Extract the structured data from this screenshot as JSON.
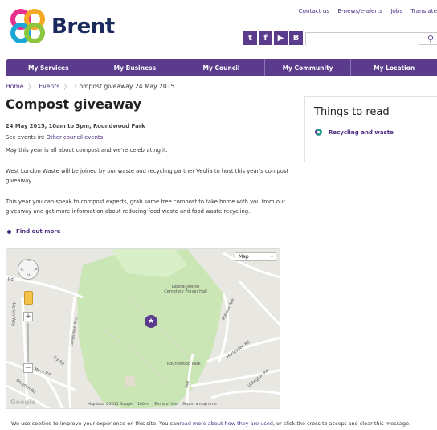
{
  "brand": {
    "name": "Brent",
    "colors": {
      "primary": "#5b3b8c",
      "link": "#4b2e83",
      "text": "#222222"
    }
  },
  "toplinks": [
    "Contact us",
    "E-news/e-alerts",
    "Jobs",
    "Translate"
  ],
  "social": [
    {
      "icon": "twitter-icon",
      "glyph": "t"
    },
    {
      "icon": "facebook-icon",
      "glyph": "f"
    },
    {
      "icon": "youtube-icon",
      "glyph": "▶"
    },
    {
      "icon": "brent-b-icon",
      "glyph": "B"
    }
  ],
  "search": {
    "placeholder": "",
    "icon": "search-icon"
  },
  "nav": [
    "My Services",
    "My Business",
    "My Council",
    "My Community",
    "My Location"
  ],
  "breadcrumb": {
    "home": "Home",
    "events": "Events",
    "current": "Compost giveaway 24 May 2015"
  },
  "page": {
    "title": "Compost giveaway",
    "meta": "24 May 2015, 10am to 3pm, Roundwood Park",
    "see_events_prefix": "See events in:",
    "see_events_link": "Other council events",
    "p1": "May this year is all about compost and we're celebrating it.",
    "p2": "West London Waste will be joined by our waste and recycling partner Veolia to host this year's compost giveaway.",
    "p3": "This year you can speak to compost experts, grab some free compost to take home with you from our giveaway and get more information about reducing food waste and food waste recycling.",
    "find_out_more": "Find out more"
  },
  "map": {
    "type_select": "Map",
    "labels": {
      "liberal": "Liberal Jewish Cemetery Prayer Hall",
      "roundwood": "Roundwood Park",
      "robson": "Robson Ave",
      "harlesden": "Harlesden Rd",
      "longstone": "Longstone Ave",
      "fry": "Fry Rd",
      "meck": "Meck Rd",
      "drayton": "Drayton Rd",
      "uffington": "Uffington Rd",
      "marian": "Marian Way",
      "rd": "Rd",
      "ave": "Ave"
    },
    "footer": {
      "data": "Map data ©2015 Google",
      "scale": "100 m",
      "terms": "Terms of Use",
      "report": "Report a map error"
    },
    "logo": "Google"
  },
  "sidebar": {
    "title": "Things to read",
    "link": "Recycling and waste"
  },
  "cookie": {
    "prefix": "We use cookies to improve your experience on this site. You can ",
    "link": "read more about how they are used",
    "suffix": ", or click the cross to accept and clear this message."
  }
}
